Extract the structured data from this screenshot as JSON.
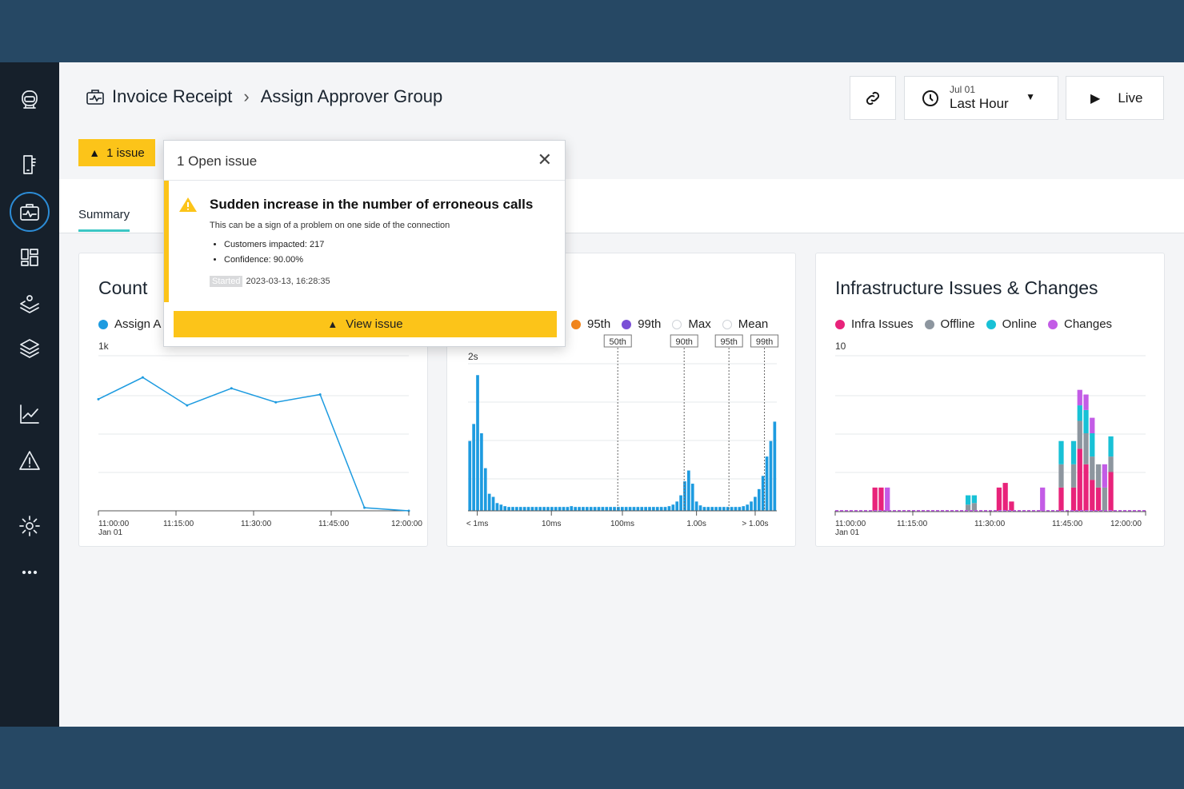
{
  "breadcrumb": {
    "parent": "Invoice Receipt",
    "current": "Assign Approver Group"
  },
  "time": {
    "date": "Jul 01",
    "range": "Last Hour"
  },
  "live_label": "Live",
  "issue_chip": "1 issue",
  "tabs": [
    {
      "label": "Summary",
      "active": true
    }
  ],
  "popup": {
    "header": "1 Open issue",
    "title": "Sudden increase in the number of erroneous calls",
    "description": "This can be a sign of a problem on one side of the connection",
    "bullets": [
      "Customers impacted: 217",
      "Confidence: 90.00%"
    ],
    "started_label": "Started",
    "started_value": "2023-03-13, 16:28:35",
    "button": "View issue"
  },
  "colors": {
    "accent": "#fcc419",
    "brand_dark": "#16202b",
    "background": "#264864",
    "tab_underline": "#3cc6c4",
    "active_icon_ring": "#2c8cd6"
  },
  "sidebar": {
    "icons": [
      "robot-icon",
      "document-icon",
      "briefcase-pulse-icon",
      "dashboard-icon",
      "stack-person-icon",
      "layers-icon",
      "chart-icon",
      "alert-icon",
      "gear-icon",
      "more-icon"
    ],
    "active": "briefcase-pulse-icon"
  },
  "chart_data": [
    {
      "type": "line",
      "title": "Count",
      "series": [
        {
          "name": "Assign A",
          "color": "#1d9be0",
          "values": [
            720,
            860,
            680,
            790,
            700,
            750,
            20,
            0
          ]
        }
      ],
      "x_ticks": [
        "11:00:00",
        "11:15:00",
        "11:30:00",
        "11:45:00",
        "12:00:00"
      ],
      "x_sub": "Jan 01",
      "y_top_label": "1k",
      "ylim": [
        0,
        1000
      ],
      "grid": true
    },
    {
      "type": "bar",
      "series": [
        {
          "name": "histogram",
          "color": "#1d9be0"
        }
      ],
      "values": [
        0.9,
        1.12,
        1.75,
        1.0,
        0.55,
        0.22,
        0.18,
        0.1,
        0.08,
        0.06,
        0.05,
        0.05,
        0.05,
        0.05,
        0.05,
        0.05,
        0.05,
        0.05,
        0.05,
        0.05,
        0.05,
        0.05,
        0.05,
        0.05,
        0.05,
        0.05,
        0.06,
        0.05,
        0.05,
        0.05,
        0.05,
        0.05,
        0.05,
        0.05,
        0.05,
        0.05,
        0.05,
        0.05,
        0.05,
        0.05,
        0.05,
        0.05,
        0.05,
        0.05,
        0.05,
        0.05,
        0.05,
        0.05,
        0.05,
        0.05,
        0.05,
        0.06,
        0.08,
        0.12,
        0.2,
        0.38,
        0.52,
        0.35,
        0.12,
        0.07,
        0.05,
        0.05,
        0.05,
        0.05,
        0.05,
        0.05,
        0.05,
        0.05,
        0.05,
        0.05,
        0.06,
        0.08,
        0.12,
        0.18,
        0.28,
        0.45,
        0.7,
        0.9,
        1.15
      ],
      "legend": [
        {
          "name": "95th",
          "color": "#f2861d",
          "filled": true
        },
        {
          "name": "99th",
          "color": "#7a4fd6",
          "filled": true
        },
        {
          "name": "Max",
          "color": "#cfd3d8",
          "filled": false
        },
        {
          "name": "Mean",
          "color": "#cfd3d8",
          "filled": false
        }
      ],
      "markers": [
        "50th",
        "90th",
        "95th",
        "99th"
      ],
      "x_ticks": [
        "< 1ms",
        "10ms",
        "100ms",
        "1.00s",
        "> 1.00s"
      ],
      "y_top_label": "2s",
      "ylim": [
        0,
        2
      ],
      "grid": true
    },
    {
      "type": "bar",
      "stacked": true,
      "title": "Infrastructure Issues & Changes",
      "series": [
        {
          "name": "Infra Issues",
          "color": "#e8237a"
        },
        {
          "name": "Offline",
          "color": "#8d969f"
        },
        {
          "name": "Online",
          "color": "#18c1d6"
        },
        {
          "name": "Changes",
          "color": "#c35ce6"
        }
      ],
      "bars": [
        {
          "slot": 6,
          "v": [
            1.5,
            0,
            0,
            0
          ],
          "cap": 1
        },
        {
          "slot": 7,
          "v": [
            1.5,
            0,
            0,
            0
          ],
          "cap": 0.5
        },
        {
          "slot": 8,
          "v": [
            0,
            0,
            0,
            1.5
          ],
          "cap": 0
        },
        {
          "slot": 21,
          "v": [
            0,
            0.4,
            0.6,
            0
          ],
          "cap": 0
        },
        {
          "slot": 22,
          "v": [
            0,
            0.5,
            0.5,
            0
          ],
          "cap": 0
        },
        {
          "slot": 26,
          "v": [
            1.5,
            0,
            0,
            0
          ],
          "cap": 1
        },
        {
          "slot": 27,
          "v": [
            1.8,
            0,
            0,
            0
          ],
          "cap": 0.5
        },
        {
          "slot": 28,
          "v": [
            0.6,
            0,
            0,
            0
          ],
          "cap": 0
        },
        {
          "slot": 33,
          "v": [
            0,
            0,
            0,
            1.5
          ],
          "cap": 0
        },
        {
          "slot": 36,
          "v": [
            1.5,
            1.5,
            1.5,
            0
          ],
          "cap": 0
        },
        {
          "slot": 38,
          "v": [
            1.5,
            1.5,
            1.5,
            0
          ],
          "cap": 0
        },
        {
          "slot": 39,
          "v": [
            4,
            1.8,
            1,
            1
          ],
          "cap": 1
        },
        {
          "slot": 40,
          "v": [
            3,
            2,
            1.5,
            1
          ],
          "cap": 0
        },
        {
          "slot": 41,
          "v": [
            2,
            1.5,
            1.5,
            1
          ],
          "cap": 0
        },
        {
          "slot": 42,
          "v": [
            1.5,
            1.5,
            0,
            0
          ],
          "cap": 0
        },
        {
          "slot": 43,
          "v": [
            0,
            1.5,
            0,
            1.5
          ],
          "cap": 0
        },
        {
          "slot": 44,
          "v": [
            2.5,
            1,
            1.3,
            0
          ],
          "cap": 0
        }
      ],
      "slots": 50,
      "x_ticks": [
        "11:00:00",
        "11:15:00",
        "11:30:00",
        "11:45:00",
        "12:00:00"
      ],
      "x_sub": "Jan 01",
      "y_top_label": "10",
      "ylim": [
        0,
        10
      ],
      "grid": true
    }
  ]
}
